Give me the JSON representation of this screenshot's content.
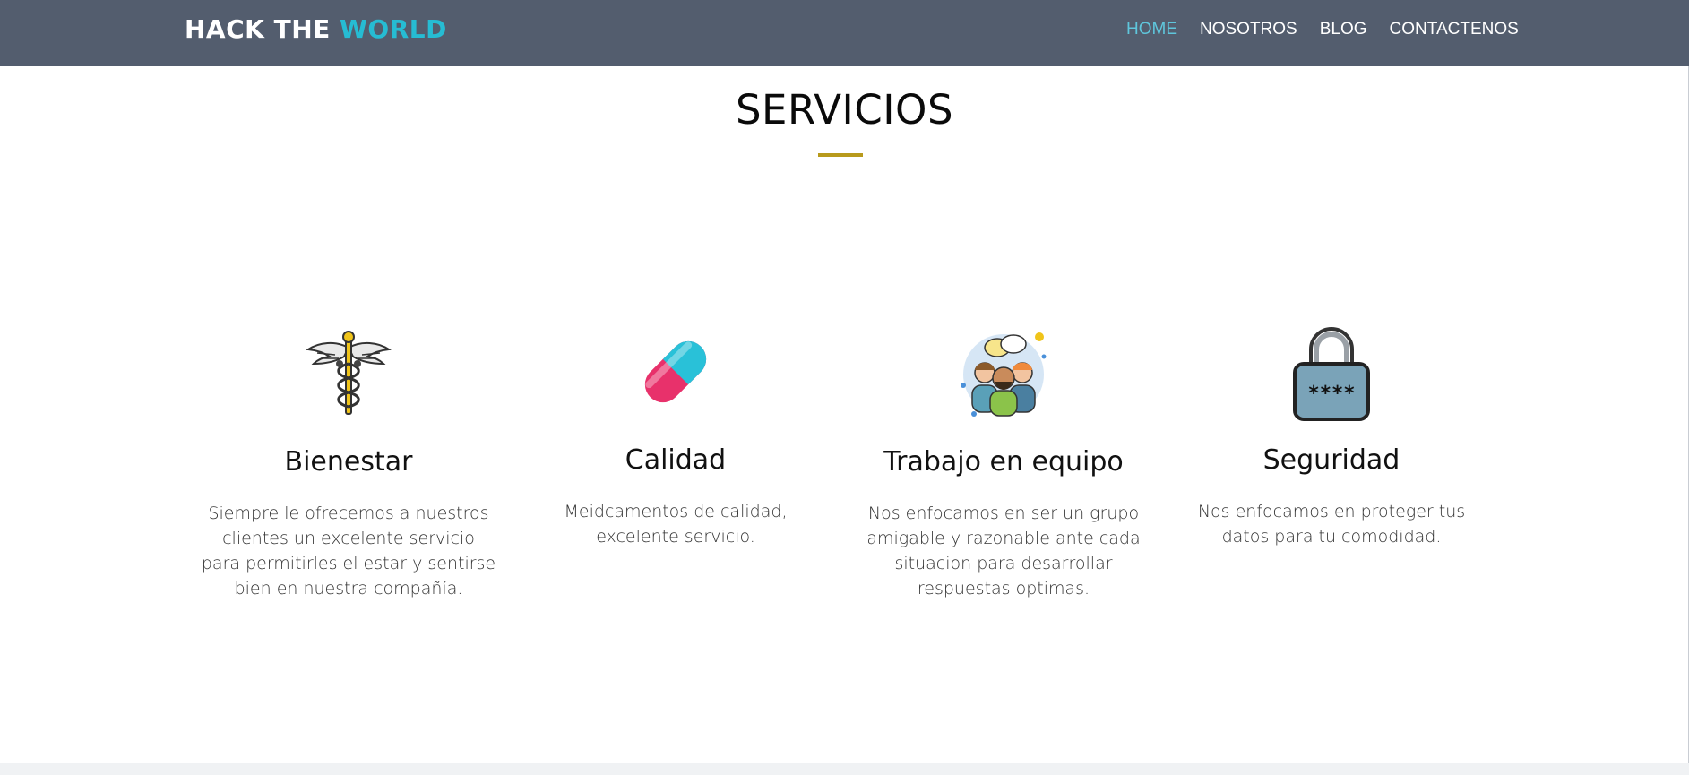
{
  "brand": {
    "part1": "HACK THE",
    "part2": "WORLD"
  },
  "nav": [
    {
      "label": "HOME",
      "active": true
    },
    {
      "label": "NOSOTROS",
      "active": false
    },
    {
      "label": "BLOG",
      "active": false
    },
    {
      "label": "CONTACTENOS",
      "active": false
    }
  ],
  "section": {
    "title": "SERVICIOS",
    "cards": [
      {
        "icon": "caduceus-icon",
        "title": "Bienestar",
        "text": "Siempre le ofrecemos a nuestros clientes un excelente servicio para permitirles el estar y sentirse bien en nuestra compañía."
      },
      {
        "icon": "pill-icon",
        "title": "Calidad",
        "text": "Meidcamentos de calidad, excelente servicio."
      },
      {
        "icon": "team-icon",
        "title": "Trabajo en equipo",
        "text": "Nos enfocamos en ser un grupo amigable y razonable ante cada situacion para desarrollar respuestas optimas."
      },
      {
        "icon": "padlock-icon",
        "title": "Seguridad",
        "text": "Nos enfocamos en proteger tus datos para tu comodidad."
      }
    ]
  },
  "colors": {
    "navbar": "#535d6e",
    "brand_accent": "#26bcd3",
    "nav_active": "#5fc6dc",
    "title_underline": "#b89a1c"
  }
}
